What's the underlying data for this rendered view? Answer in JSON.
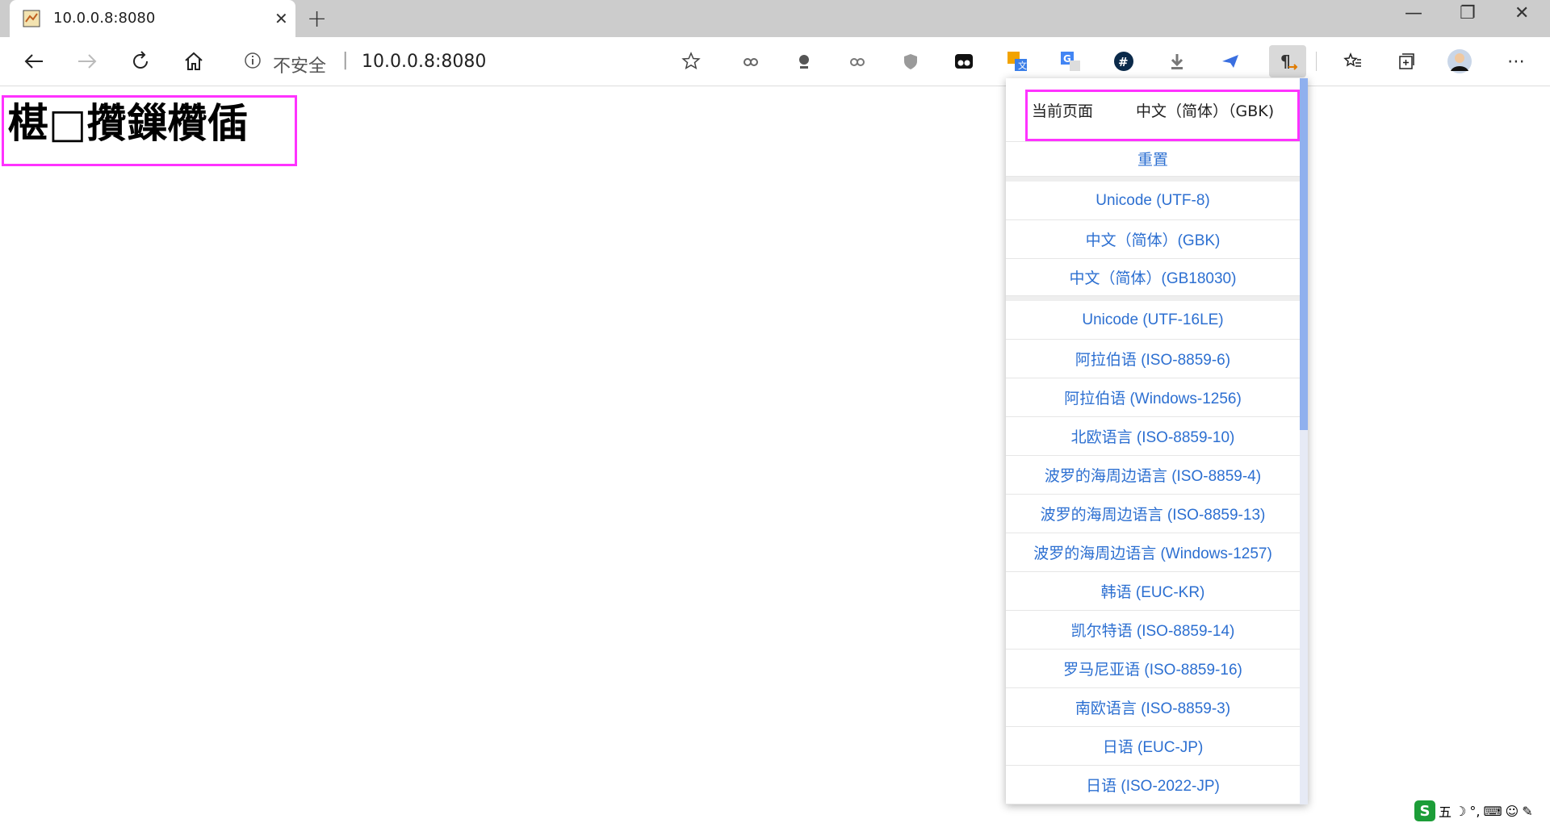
{
  "tab": {
    "title": "10.0.0.8:8080",
    "close": "✕"
  },
  "newtab": "+",
  "window": {
    "minimize": "—",
    "restore": "❐",
    "close": "✕"
  },
  "address": {
    "insecure_label": "不安全",
    "separator": "|",
    "url": "10.0.0.8:8080"
  },
  "extensions": [
    "Hex/code extension",
    "Colorful icon",
    "Gear extension",
    "Shield extension",
    "Tampermonkey",
    "Translate",
    "Google Translate",
    "Hash extension",
    "Download",
    "Send",
    "Charset"
  ],
  "page": {
    "heading": "椹□攢鏁欑偛"
  },
  "popup": {
    "current_label": "当前页面",
    "current_value": "中文（简体）（GBK)",
    "reset": "重置",
    "group1": [
      "Unicode (UTF-8)",
      "中文（简体）(GBK)",
      "中文（简体）(GB18030)"
    ],
    "group2": [
      "Unicode (UTF-16LE)",
      "阿拉伯语 (ISO-8859-6)",
      "阿拉伯语 (Windows-1256)",
      "北欧语言 (ISO-8859-10)",
      "波罗的海周边语言 (ISO-8859-4)",
      "波罗的海周边语言 (ISO-8859-13)",
      "波罗的海周边语言 (Windows-1257)",
      "韩语 (EUC-KR)",
      "凯尔特语 (ISO-8859-14)",
      "罗马尼亚语 (ISO-8859-16)",
      "南欧语言 (ISO-8859-3)",
      "日语 (EUC-JP)",
      "日语 (ISO-2022-JP)"
    ]
  },
  "tray": {
    "s_label": "S",
    "wu_label": "五"
  },
  "colors": {
    "accent": "#2c6fd1",
    "highlight": "#ff33ff",
    "titlebar": "#cccccc",
    "scroll_thumb": "#8fb0ee"
  }
}
